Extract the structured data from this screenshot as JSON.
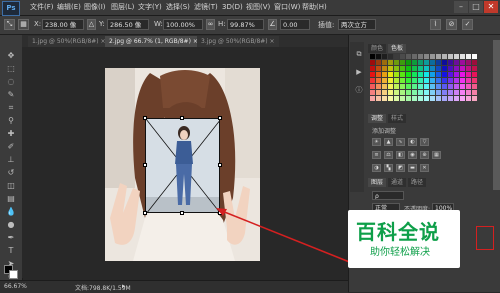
{
  "menubar": {
    "app_logo": "Ps",
    "items": [
      "文件(F)",
      "编辑(E)",
      "图像(I)",
      "图层(L)",
      "文字(Y)",
      "选择(S)",
      "滤镜(T)",
      "3D(D)",
      "视图(V)",
      "窗口(W)",
      "帮助(H)"
    ]
  },
  "options_bar": {
    "x_label": "X:",
    "x_value": "238.00 像",
    "y_label": "Y:",
    "y_value": "286.50 像",
    "w_label": "W:",
    "w_value": "100.00%",
    "h_label": "H:",
    "h_value": "99.87%",
    "angle_value": "0.00",
    "interp_label": "插值:",
    "interp_value": "两次立方"
  },
  "tabs": [
    {
      "label": "1.jpg @ 50%(RGB/8#) ×",
      "active": false
    },
    {
      "label": "2.jpg @ 66.7% (1, RGB/8#) ×",
      "active": true
    },
    {
      "label": "3.jpg @ 50%(RGB/8#) ×",
      "active": false
    }
  ],
  "status_bar": {
    "zoom": "66.67%",
    "doc_info": "文档:798.8K/1.59M"
  },
  "panels": {
    "color_tabs": [
      "颜色",
      "色板"
    ],
    "adjust_tabs": [
      "调整",
      "样式"
    ],
    "adjust_title": "添加调整",
    "layers_tabs": [
      "图层",
      "通道",
      "路径"
    ],
    "layers_mode": "正常",
    "layers_opacity_label": "不透明度:",
    "layers_opacity_value": "100%"
  },
  "watermark": {
    "title": "百科全说",
    "subtitle": "助你轻松解决"
  },
  "colors": {
    "accent_red": "#d42020",
    "watermark_green": "#0e9f49"
  }
}
